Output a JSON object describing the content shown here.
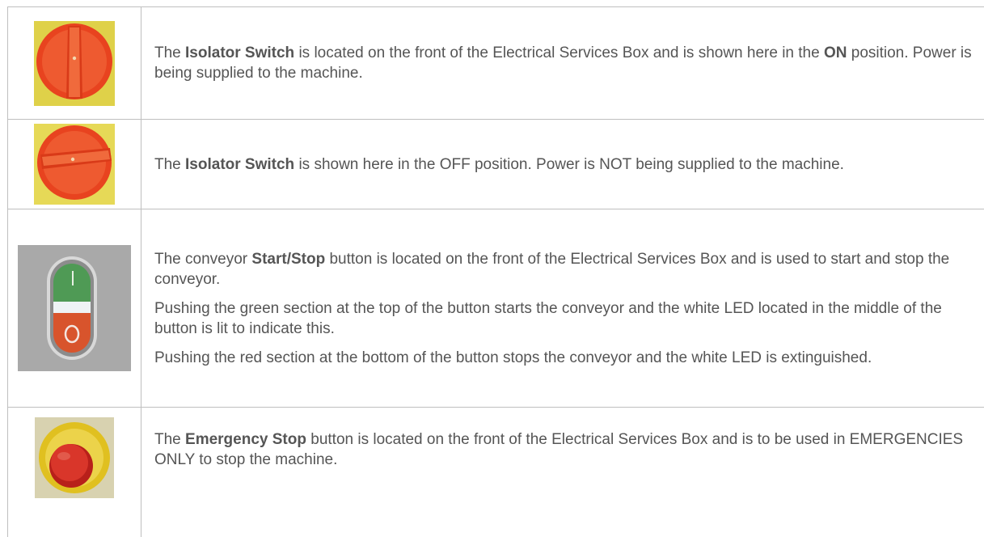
{
  "rows": [
    {
      "image_icon": "isolator-switch-on-icon",
      "paragraphs": [
        {
          "segments": [
            {
              "text": "The ",
              "bold": false
            },
            {
              "text": "Isolator Switch",
              "bold": true
            },
            {
              "text": " is located on the front of the Electrical Services Box and is shown here in the ",
              "bold": false
            },
            {
              "text": "ON",
              "bold": true
            },
            {
              "text": " position. Power is being supplied to the machine.",
              "bold": false
            }
          ]
        }
      ]
    },
    {
      "image_icon": "isolator-switch-off-icon",
      "paragraphs": [
        {
          "segments": [
            {
              "text": "The ",
              "bold": false
            },
            {
              "text": "Isolator Switch",
              "bold": true
            },
            {
              "text": " is shown here in the OFF position. Power is NOT being supplied to the machine.",
              "bold": false
            }
          ]
        }
      ]
    },
    {
      "image_icon": "start-stop-button-icon",
      "paragraphs": [
        {
          "segments": [
            {
              "text": "The conveyor ",
              "bold": false
            },
            {
              "text": "Start/Stop",
              "bold": true
            },
            {
              "text": " button is located on the front of the Electrical Services Box and is used to start and stop the conveyor.",
              "bold": false
            }
          ]
        },
        {
          "segments": [
            {
              "text": "Pushing the green section at the top of the button starts the conveyor and the white LED located in the middle of the button is lit to indicate this.",
              "bold": false
            }
          ]
        },
        {
          "segments": [
            {
              "text": "Pushing the red section at the bottom of the button stops the conveyor and the white LED is extinguished.",
              "bold": false
            }
          ]
        }
      ]
    },
    {
      "image_icon": "emergency-stop-button-icon",
      "paragraphs": [
        {
          "segments": [
            {
              "text": "The ",
              "bold": false
            },
            {
              "text": "Emergency Stop",
              "bold": true
            },
            {
              "text": " button is located on the front of the Electrical Services Box and is to be used in EMERGENCIES ONLY to stop the machine.",
              "bold": false
            }
          ]
        }
      ]
    }
  ],
  "colors": {
    "text": "#555555",
    "border": "#bfbfbf",
    "switch_red": "#e8431f",
    "switch_yellow": "#e2d23a",
    "button_green": "#4f9a55",
    "button_red": "#d8542c",
    "button_housing": "#a7a7a7"
  }
}
